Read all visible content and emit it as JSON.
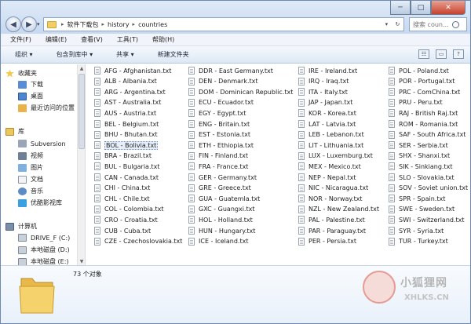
{
  "window": {
    "minimize": "─",
    "maximize": "□",
    "close": "✕"
  },
  "address": {
    "crumbs": [
      "软件下载包",
      "history",
      "countries"
    ]
  },
  "search": {
    "placeholder": "搜索 coun..."
  },
  "menu": [
    "文件(F)",
    "编辑(E)",
    "查看(V)",
    "工具(T)",
    "帮助(H)"
  ],
  "toolbar": [
    "组织 ▾",
    "包含到库中 ▾",
    "共享 ▾",
    "新建文件夹"
  ],
  "sidebar": {
    "favorites": "收藏夹",
    "downloads": "下载",
    "desktop": "桌面",
    "recent": "最近访问的位置",
    "libraries": "库",
    "subversion": "Subversion",
    "videos": "视频",
    "pictures": "图片",
    "documents": "文档",
    "music": "音乐",
    "youku": "优酷影视库",
    "computer": "计算机",
    "drive_f": "DRIVE_F (C:)",
    "local_d": "本地磁盘 (D:)",
    "local_e": "本地磁盘 (E:)"
  },
  "files": {
    "col1": [
      "AFG - Afghanistan.txt",
      "ALB - Albania.txt",
      "ARG - Argentina.txt",
      "AST - Australia.txt",
      "AUS - Austria.txt",
      "BEL - Belgium.txt",
      "BHU - Bhutan.txt",
      "BOL - Bolivia.txt",
      "BRA - Brazil.txt",
      "BUL - Bulgaria.txt",
      "CAN - Canada.txt",
      "CHI - China.txt",
      "CHL - Chile.txt",
      "COL - Colombia.txt",
      "CRO - Croatia.txt",
      "CUB - Cuba.txt",
      "CZE - Czechoslovakia.txt"
    ],
    "col2": [
      "DDR - East Germany.txt",
      "DEN - Denmark.txt",
      "DOM - Dominican Republic.txt",
      "ECU - Ecuador.txt",
      "EGY - Egypt.txt",
      "ENG - Britain.txt",
      "EST - Estonia.txt",
      "ETH - Ethiopia.txt",
      "FIN - Finland.txt",
      "FRA - France.txt",
      "GER - Germany.txt",
      "GRE - Greece.txt",
      "GUA - Guatemla.txt",
      "GXC - Guangxi.txt",
      "HOL - Holland.txt",
      "HUN - Hungary.txt",
      "ICE - Iceland.txt"
    ],
    "col3": [
      "IRE - Ireland.txt",
      "IRQ - Iraq.txt",
      "ITA - Italy.txt",
      "JAP - Japan.txt",
      "KOR - Korea.txt",
      "LAT - Latvia.txt",
      "LEB - Lebanon.txt",
      "LIT - Lithuania.txt",
      "LUX - Luxemburg.txt",
      "MEX - Mexico.txt",
      "NEP - Nepal.txt",
      "NIC - Nicaragua.txt",
      "NOR - Norway.txt",
      "NZL - New Zealand.txt",
      "PAL - Palestine.txt",
      "PAR - Paraguay.txt",
      "PER - Persia.txt"
    ],
    "col4": [
      "POL - Poland.txt",
      "POR - Portugal.txt",
      "PRC - ComChina.txt",
      "PRU - Peru.txt",
      "RAJ - British Raj.txt",
      "ROM - Romania.txt",
      "SAF - South Africa.txt",
      "SER - Serbia.txt",
      "SHX - Shanxi.txt",
      "SIK - Sinkiang.txt",
      "SLO - Slovakia.txt",
      "SOV - Soviet union.txt",
      "SPR - Spain.txt",
      "SWE - Sweden.txt",
      "SWI - Switzerland.txt",
      "SYR - Syria.txt",
      "TUR - Turkey.txt"
    ]
  },
  "status": {
    "count": "73 个对象"
  },
  "watermark": {
    "cn": "小狐狸网",
    "url": "XHLKS.CN"
  }
}
